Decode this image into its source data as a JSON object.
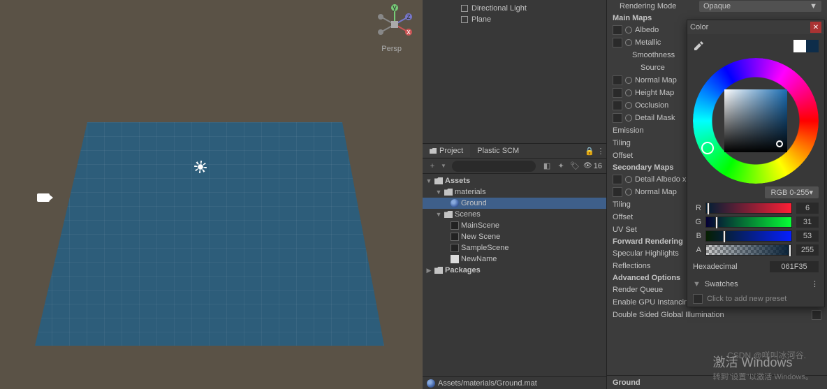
{
  "scene": {
    "persp_label": "Persp",
    "axes": {
      "x": "x",
      "y": "y",
      "z": "z"
    }
  },
  "hierarchy": {
    "items": [
      "Directional Light",
      "Plane"
    ]
  },
  "project": {
    "tabs": [
      "Project",
      "Plastic SCM"
    ],
    "visible_count": "16",
    "tree": {
      "root": "Assets",
      "materials": {
        "label": "materials",
        "items": [
          "Ground"
        ]
      },
      "scenes": {
        "label": "Scenes",
        "items": [
          "MainScene",
          "New Scene",
          "SampleScene",
          "NewName"
        ]
      },
      "packages": "Packages"
    },
    "footer_path": "Assets/materials/Ground.mat"
  },
  "inspector": {
    "rendering_mode": {
      "label": "Rendering Mode",
      "value": "Opaque"
    },
    "main_maps": {
      "header": "Main Maps",
      "albedo": "Albedo",
      "metallic": "Metallic",
      "smoothness": "Smoothness",
      "source": "Source",
      "normal_map": "Normal Map",
      "height_map": "Height Map",
      "occlusion": "Occlusion",
      "detail_mask": "Detail Mask",
      "emission": "Emission",
      "tiling": "Tiling",
      "offset": "Offset"
    },
    "secondary_maps": {
      "header": "Secondary Maps",
      "detail_albedo": "Detail Albedo x",
      "normal_map": "Normal Map",
      "tiling": "Tiling",
      "offset": "Offset",
      "uv_set": "UV Set"
    },
    "forward_rendering": {
      "header": "Forward Rendering",
      "specular": "Specular Highlights",
      "reflections": "Reflections"
    },
    "advanced": {
      "header": "Advanced Options",
      "render_queue": "Render Queue",
      "gpu_instancing": "Enable GPU Instancing",
      "double_sided": "Double Sided Global Illumination"
    },
    "footer": "Ground"
  },
  "color_picker": {
    "title": "Color",
    "mode": "RGB 0-255",
    "r": {
      "label": "R",
      "value": "6"
    },
    "g": {
      "label": "G",
      "value": "31"
    },
    "b": {
      "label": "B",
      "value": "53"
    },
    "a": {
      "label": "A",
      "value": "255"
    },
    "hex_label": "Hexadecimal",
    "hex_value": "061F35",
    "swatches_label": "Swatches",
    "preset_hint": "Click to add new preset",
    "current_color": "#ffffff",
    "new_color": "#0e2d4a"
  },
  "watermark": {
    "line1": "激活 Windows",
    "line2": "转到\"设置\"以激活 Windows。",
    "csdn": "CSDN @咩叫冰河谷."
  }
}
